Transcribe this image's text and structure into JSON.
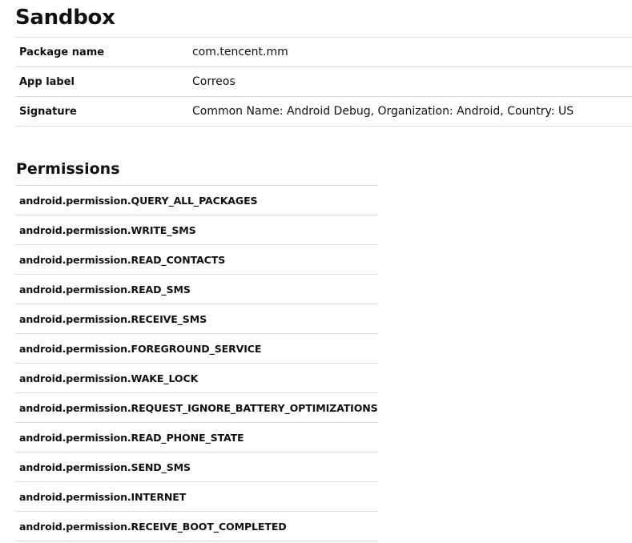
{
  "page_title": "Sandbox",
  "info": [
    {
      "label": "Package name",
      "value": "com.tencent.mm"
    },
    {
      "label": "App label",
      "value": "Correos"
    },
    {
      "label": "Signature",
      "value": "Common Name: Android Debug, Organization: Android, Country: US"
    }
  ],
  "permissions_heading": "Permissions",
  "permissions": [
    "android.permission.QUERY_ALL_PACKAGES",
    "android.permission.WRITE_SMS",
    "android.permission.READ_CONTACTS",
    "android.permission.READ_SMS",
    "android.permission.RECEIVE_SMS",
    "android.permission.FOREGROUND_SERVICE",
    "android.permission.WAKE_LOCK",
    "android.permission.REQUEST_IGNORE_BATTERY_OPTIMIZATIONS",
    "android.permission.READ_PHONE_STATE",
    "android.permission.SEND_SMS",
    "android.permission.INTERNET",
    "android.permission.RECEIVE_BOOT_COMPLETED"
  ]
}
